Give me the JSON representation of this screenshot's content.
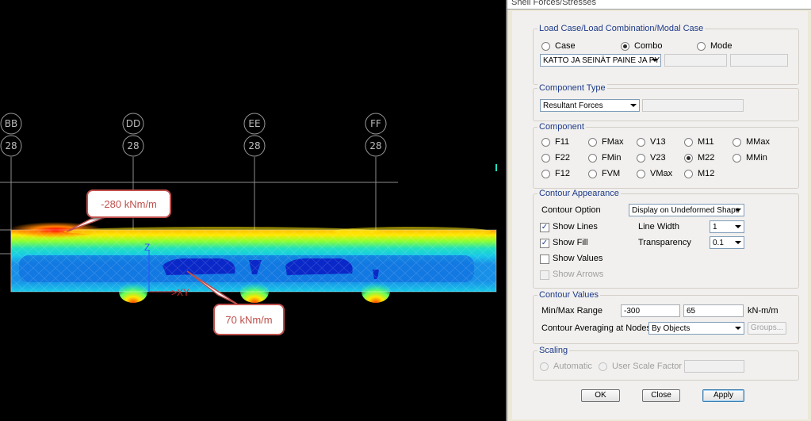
{
  "viewport": {
    "grid_bubbles": [
      {
        "top": "BB",
        "bottom": "28"
      },
      {
        "top": "DD",
        "bottom": "28"
      },
      {
        "top": "EE",
        "bottom": "28"
      },
      {
        "top": "FF",
        "bottom": "28"
      }
    ],
    "callouts": {
      "min_label": "-280 kNm/m",
      "max_label": "70 kNm/m"
    },
    "axis": {
      "z": "Z",
      "xy": ">XY"
    },
    "colors": {
      "callout_border": "#c0504d",
      "background": "#000000"
    }
  },
  "dialog": {
    "title": "Shell Forces/Stresses",
    "load_case": {
      "title": "Load Case/Load Combination/Modal Case",
      "options": [
        "Case",
        "Combo",
        "Mode"
      ],
      "selected": "Combo",
      "combo_value": "KATTO JA SEINÄT PAINE JA PYSY"
    },
    "component_type": {
      "title": "Component Type",
      "value": "Resultant Forces"
    },
    "component": {
      "title": "Component",
      "options": [
        "F11",
        "FMax",
        "V13",
        "M11",
        "MMax",
        "F22",
        "FMin",
        "V23",
        "M22",
        "MMin",
        "F12",
        "FVM",
        "VMax",
        "M12"
      ],
      "selected": "M22"
    },
    "contour_appearance": {
      "title": "Contour Appearance",
      "contour_option_label": "Contour Option",
      "contour_option_value": "Display on Undeformed Shape",
      "show_lines": "Show Lines",
      "show_fill": "Show Fill",
      "show_values": "Show Values",
      "show_arrows": "Show Arrows",
      "line_width_label": "Line Width",
      "line_width_value": "1",
      "transparency_label": "Transparency",
      "transparency_value": "0.1"
    },
    "contour_values": {
      "title": "Contour Values",
      "range_label": "Min/Max Range",
      "min": "-300",
      "max": "65",
      "units": "kN-m/m",
      "averaging_label": "Contour Averaging at Nodes",
      "averaging_value": "By Objects",
      "groups_button": "Groups..."
    },
    "scaling": {
      "title": "Scaling",
      "automatic": "Automatic",
      "user_scale": "User Scale Factor"
    },
    "buttons": {
      "ok": "OK",
      "close": "Close",
      "apply": "Apply"
    }
  }
}
